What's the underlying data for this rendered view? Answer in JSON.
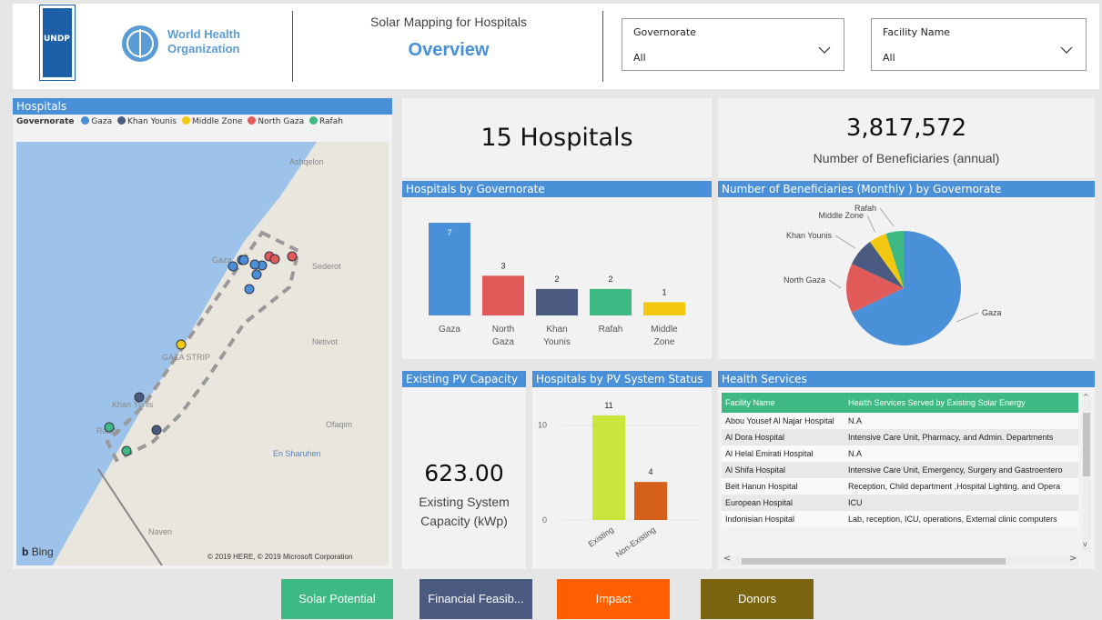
{
  "header": {
    "app_title": "Solar Mapping for Hospitals",
    "page_title": "Overview",
    "undp_logo_text": "UNDP",
    "who_logo_text": "World Health Organization",
    "filters": [
      {
        "label": "Governorate",
        "value": "All"
      },
      {
        "label": "Facility Name",
        "value": "All"
      }
    ]
  },
  "map_panel": {
    "title": "Hospitals",
    "legend_title": "Governorate",
    "legend": [
      {
        "name": "Gaza",
        "color": "#4a90d9"
      },
      {
        "name": "Khan Younis",
        "color": "#4a5a80"
      },
      {
        "name": "Middle Zone",
        "color": "#f2c811"
      },
      {
        "name": "North Gaza",
        "color": "#e05a5a"
      },
      {
        "name": "Rafah",
        "color": "#3fb984"
      }
    ],
    "place_labels": [
      "Ashqelon",
      "Gaza",
      "Sederot",
      "Netivot",
      "GAZA STRIP",
      "Khan Yunis",
      "Rafah",
      "Ofaqim",
      "En Sharuhen",
      "Naven"
    ],
    "bing_label": "Bing",
    "copyright": "© 2019 HERE, © 2019 Microsoft Corporation"
  },
  "kpi_hospitals": {
    "value": "15",
    "unit": "Hospitals"
  },
  "kpi_beneficiaries": {
    "value": "3,817,572",
    "caption": "Number of Beneficiaries (annual)"
  },
  "bar_governorate": {
    "title": "Hospitals by Governorate",
    "chart_data": {
      "type": "bar",
      "categories": [
        "Gaza",
        "North Gaza",
        "Khan Younis",
        "Rafah",
        "Middle Zone"
      ],
      "category_lines": [
        [
          "Gaza"
        ],
        [
          "North",
          "Gaza"
        ],
        [
          "Khan",
          "Younis"
        ],
        [
          "Rafah"
        ],
        [
          "Middle",
          "Zone"
        ]
      ],
      "values": [
        7,
        3,
        2,
        2,
        1
      ],
      "colors": [
        "#4a90d9",
        "#e05a5a",
        "#4a5a80",
        "#3fb984",
        "#f2c811"
      ],
      "ylim": [
        0,
        7
      ]
    }
  },
  "pie_beneficiaries": {
    "title": "Number of Beneficiaries (Monthly ) by Governorate",
    "chart_data": {
      "type": "pie",
      "labels": [
        "Gaza",
        "North Gaza",
        "Khan Younis",
        "Middle Zone",
        "Rafah"
      ],
      "values": [
        68,
        14,
        8,
        5,
        5
      ],
      "colors": [
        "#4a90d9",
        "#e05a5a",
        "#4a5a80",
        "#f2c811",
        "#3fb984"
      ]
    }
  },
  "pv_capacity": {
    "title": "Existing PV Capacity",
    "value": "623.00",
    "caption_line1": "Existing System",
    "caption_line2": "Capacity (kWp)"
  },
  "bar_pv_status": {
    "title": "Hospitals by PV System Status",
    "chart_data": {
      "type": "bar",
      "categories": [
        "Existing",
        "Non-Existing"
      ],
      "values": [
        11,
        4
      ],
      "colors": [
        "#c8e63c",
        "#d4601a"
      ],
      "yticks": [
        0,
        10
      ],
      "ylim": [
        0,
        13
      ]
    }
  },
  "health_services": {
    "title": "Health Services",
    "columns": [
      "Facility Name",
      "Health Services Served by Existing Solar Energy"
    ],
    "rows": [
      [
        "Abou Yousef Al Najar Hospital",
        "N.A"
      ],
      [
        "Al Dora Hospital",
        "Intensive Care Unit, Pharmacy, and Admin. Departments"
      ],
      [
        "Al Helal Emirati Hospital",
        "N.A"
      ],
      [
        "Al Shifa Hospital",
        "Intensive Care Unit, Emergency, Surgery and Gastroentero"
      ],
      [
        "Beit Hanun Hospital",
        "Reception, Child department ,Hospital Lighting, and Opera"
      ],
      [
        "European Hospital",
        "ICU"
      ],
      [
        "Indonisian Hospital",
        "Lab, reception, ICU, operations, External clinic computers"
      ]
    ]
  },
  "nav_buttons": [
    {
      "label": "Solar Potential",
      "color": "#3fb984"
    },
    {
      "label": "Financial Feasib...",
      "color": "#4a5a80"
    },
    {
      "label": "Impact",
      "color": "#ff5f00"
    },
    {
      "label": "Donors",
      "color": "#7a6410"
    }
  ]
}
